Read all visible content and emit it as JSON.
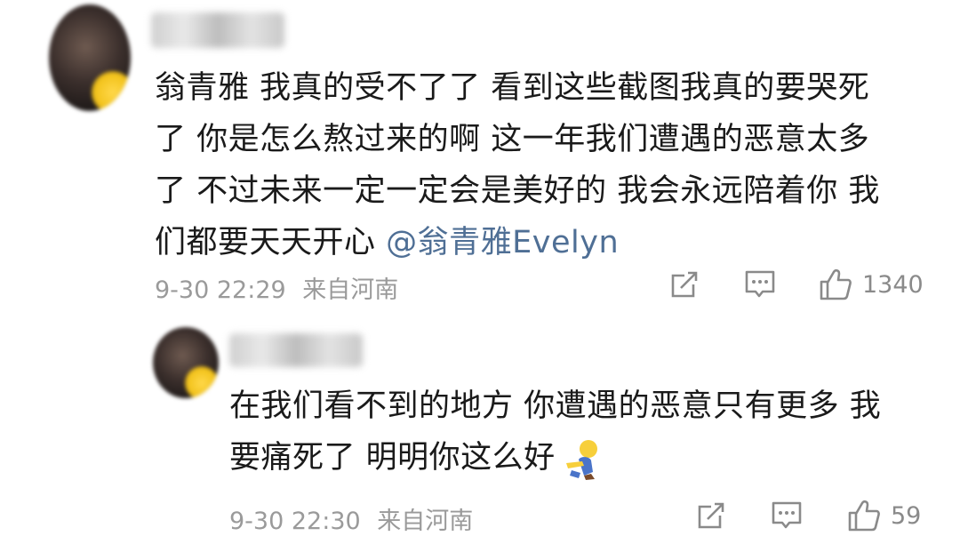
{
  "comments": [
    {
      "author": "",
      "text_lines": [
        "翁青雅 我真的受不了了 看到这些截图我真的要哭死",
        "了 你是怎么熬过来的啊 这一年我们遭遇的恶意太多",
        "了 不过未来一定一定会是美好的 我会永远陪着你 我",
        "们都要天天开心 "
      ],
      "mention": "@翁青雅Evelyn",
      "timestamp": "9-30 22:29",
      "location": "来自河南",
      "like_count": "1340",
      "actions": [
        "repost-icon",
        "comment-icon",
        "like-icon"
      ]
    },
    {
      "author": "",
      "text_lines": [
        "在我们看不到的地方 你遭遇的恶意只有更多 我",
        "要痛死了 明明你这么好"
      ],
      "emoji": "hug-emoji",
      "timestamp": "9-30 22:30",
      "location": "来自河南",
      "like_count": "59",
      "actions": [
        "repost-icon",
        "comment-icon",
        "like-icon"
      ]
    }
  ],
  "colors": {
    "text": "#1a1a1a",
    "meta": "#9a9a9a",
    "mention": "#4f6f95",
    "icon": "#8a8a8a"
  }
}
